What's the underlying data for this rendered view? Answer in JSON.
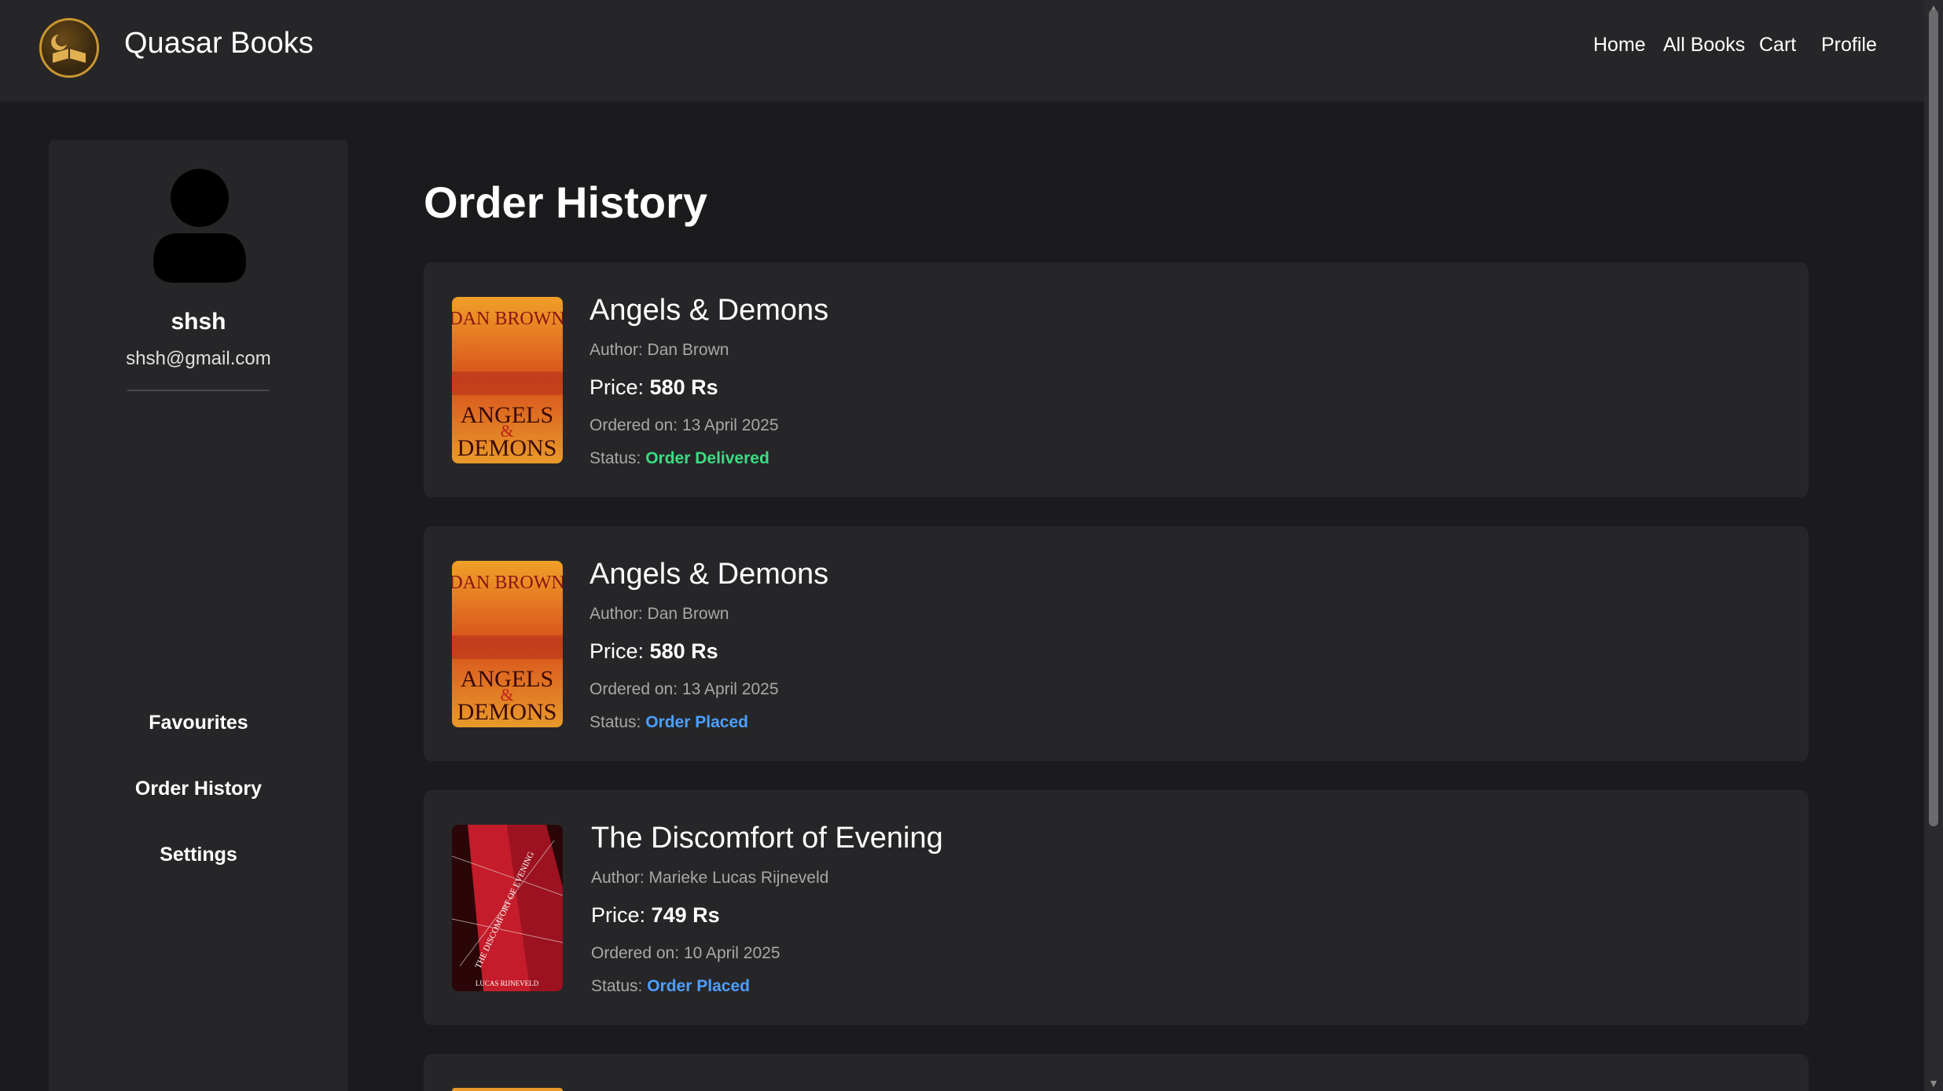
{
  "header": {
    "brand": "Quasar Books",
    "nav": [
      "Home",
      "All Books",
      "Cart",
      "Profile"
    ]
  },
  "sidebar": {
    "username": "shsh",
    "email": "shsh@gmail.com",
    "links": [
      "Favourites",
      "Order History",
      "Settings"
    ]
  },
  "main": {
    "title": "Order History",
    "orders": [
      {
        "title": "Angels & Demons",
        "author": "Author: Dan Brown",
        "price_label": "Price:",
        "price": "580 Rs",
        "ordered": "Ordered on: 13 April 2025",
        "status_label": "Status:",
        "status": "Order Delivered",
        "cover": {
          "top": "DAN BROWN",
          "mid": "ANGELS",
          "amp": "&",
          "bottom": "DEMONS"
        }
      },
      {
        "title": "Angels & Demons",
        "author": "Author: Dan Brown",
        "price_label": "Price:",
        "price": "580 Rs",
        "ordered": "Ordered on: 13 April 2025",
        "status_label": "Status:",
        "status": "Order Placed",
        "cover": {
          "top": "DAN BROWN",
          "mid": "ANGELS",
          "amp": "&",
          "bottom": "DEMONS"
        }
      },
      {
        "title": "The Discomfort of Evening",
        "author": "Author: Marieke Lucas Rijneveld",
        "price_label": "Price:",
        "price": "749 Rs",
        "ordered": "Ordered on: 10 April 2025",
        "status_label": "Status:",
        "status": "Order Placed",
        "cover": {
          "title": "THE DISCOMFORT OF EVENING",
          "author": "LUCAS RIJNEVELD"
        }
      }
    ]
  },
  "colors": {
    "delivered": "#3ddc84",
    "placed": "#4d9fff",
    "accent": "#c9962f"
  },
  "icons": [
    "logo-icon",
    "user-avatar-icon",
    "scroll-up-arrow-icon",
    "scroll-down-arrow-icon"
  ]
}
